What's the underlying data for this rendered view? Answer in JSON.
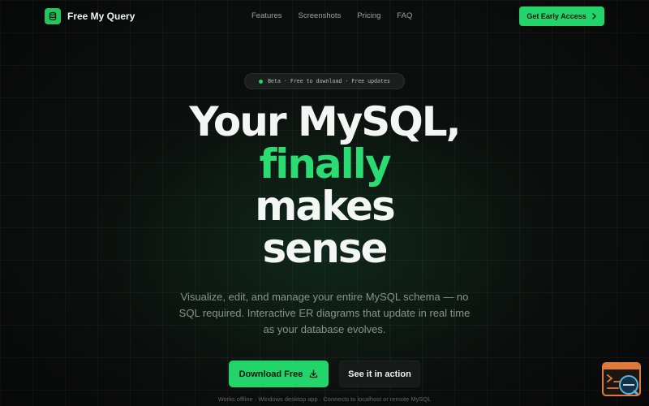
{
  "header": {
    "brand": "Free My Query",
    "nav": [
      "Features",
      "Screenshots",
      "Pricing",
      "FAQ"
    ],
    "cta_label": "Get Early Access",
    "icons": {
      "logo": "database-icon",
      "cta": "chevron-right-icon"
    }
  },
  "hero": {
    "badge": "Beta · Free to download · Free updates",
    "headline": [
      "Your MySQL,",
      "finally",
      "makes",
      "sense"
    ],
    "subtitle": "Visualize, edit, and manage your entire MySQL schema — no SQL required. Interactive ER diagrams that update in real time as your database evolves.",
    "primary_button": "Download Free",
    "secondary_button": "See it in action",
    "footnote": "Works offline · Windows desktop app · Connects to localhost or remote MySQL"
  },
  "widget": {
    "icon": "terminal-search-icon"
  },
  "colors": {
    "accent": "#22d46a",
    "background": "#0c0e0d",
    "widget_border": "#e07a3a"
  }
}
